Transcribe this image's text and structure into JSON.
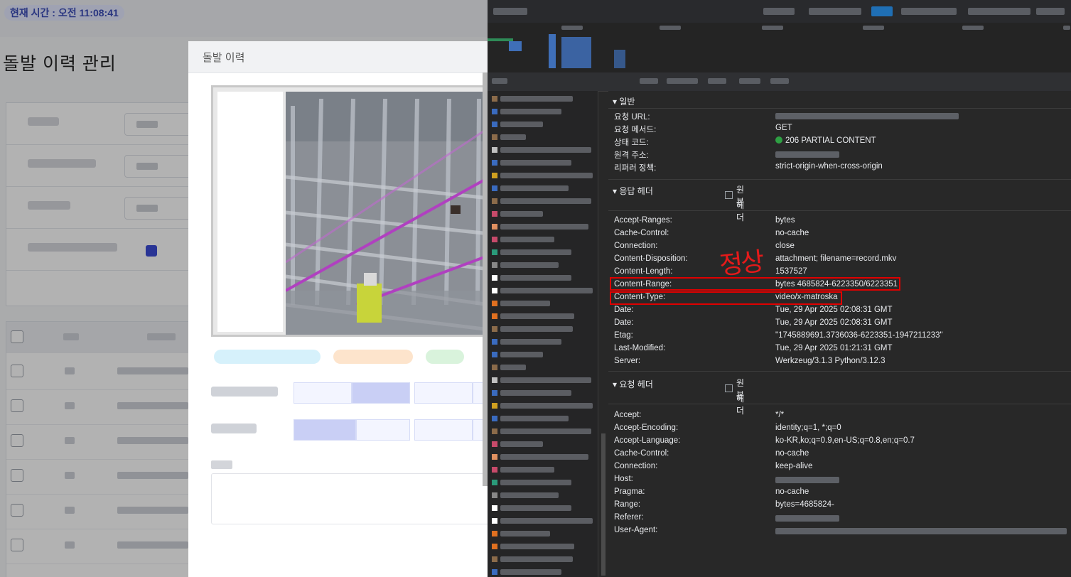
{
  "app": {
    "current_time": "현재 시간 : 오전 11:08:41",
    "page_title": "돌발 이력 관리"
  },
  "modal": {
    "title": "돌발 이력"
  },
  "devtools": {
    "general": {
      "title": "일반",
      "rows": [
        {
          "name": "요청 URL:",
          "value": ""
        },
        {
          "name": "요청 메서드:",
          "value": "GET"
        },
        {
          "name": "상태 코드:",
          "value": "206 PARTIAL CONTENT"
        },
        {
          "name": "원격 주소:",
          "value": ""
        },
        {
          "name": "리퍼러 정책:",
          "value": "strict-origin-when-cross-origin"
        }
      ]
    },
    "response_headers": {
      "title": "응답 헤더",
      "raw_label_1": "원본",
      "raw_label_2": "헤더",
      "rows": [
        {
          "name": "Accept-Ranges:",
          "value": "bytes"
        },
        {
          "name": "Cache-Control:",
          "value": "no-cache"
        },
        {
          "name": "Connection:",
          "value": "close"
        },
        {
          "name": "Content-Disposition:",
          "value": "attachment; filename=record.mkv"
        },
        {
          "name": "Content-Length:",
          "value": "1537527"
        },
        {
          "name": "Content-Range:",
          "value": "bytes 4685824-6223350/6223351"
        },
        {
          "name": "Content-Type:",
          "value": "video/x-matroska"
        },
        {
          "name": "Date:",
          "value": "Tue, 29 Apr 2025 02:08:31 GMT"
        },
        {
          "name": "Date:",
          "value": "Tue, 29 Apr 2025 02:08:31 GMT"
        },
        {
          "name": "Etag:",
          "value": "\"1745889691.3736036-6223351-1947211233\""
        },
        {
          "name": "Last-Modified:",
          "value": "Tue, 29 Apr 2025 01:21:31 GMT"
        },
        {
          "name": "Server:",
          "value": "Werkzeug/3.1.3 Python/3.12.3"
        }
      ]
    },
    "request_headers": {
      "title": "요청 헤더",
      "raw_label_1": "원본",
      "raw_label_2": "헤더",
      "rows": [
        {
          "name": "Accept:",
          "value": "*/*"
        },
        {
          "name": "Accept-Encoding:",
          "value": "identity;q=1, *;q=0"
        },
        {
          "name": "Accept-Language:",
          "value": "ko-KR,ko;q=0.9,en-US;q=0.8,en;q=0.7"
        },
        {
          "name": "Cache-Control:",
          "value": "no-cache"
        },
        {
          "name": "Connection:",
          "value": "keep-alive"
        },
        {
          "name": "Host:",
          "value": ""
        },
        {
          "name": "Pragma:",
          "value": "no-cache"
        },
        {
          "name": "Range:",
          "value": "bytes=4685824-"
        },
        {
          "name": "Referer:",
          "value": ""
        },
        {
          "name": "User-Agent:",
          "value": ""
        }
      ]
    },
    "annotation": "정상",
    "status_color": "#2ea043",
    "highlight_color": "#e00000"
  }
}
